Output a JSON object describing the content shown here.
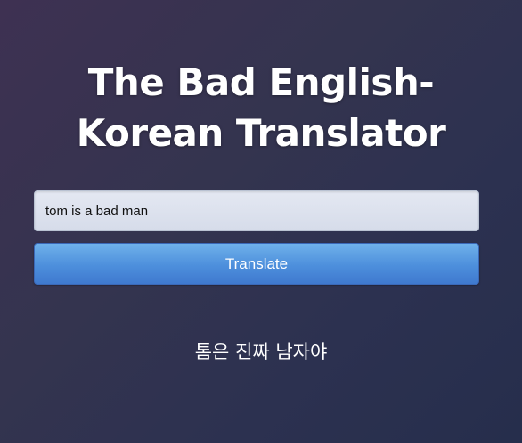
{
  "title": {
    "line1": "The Bad English-",
    "line2": "Korean Translator"
  },
  "input": {
    "value": "tom is a bad man",
    "placeholder": ""
  },
  "translate_button": {
    "label": "Translate"
  },
  "output": {
    "text": "톰은 진짜 남자야"
  },
  "colors": {
    "background": "#322f4f",
    "button": "#4d8fdc",
    "input_bg": "#dde2ee",
    "text": "#ffffff"
  }
}
